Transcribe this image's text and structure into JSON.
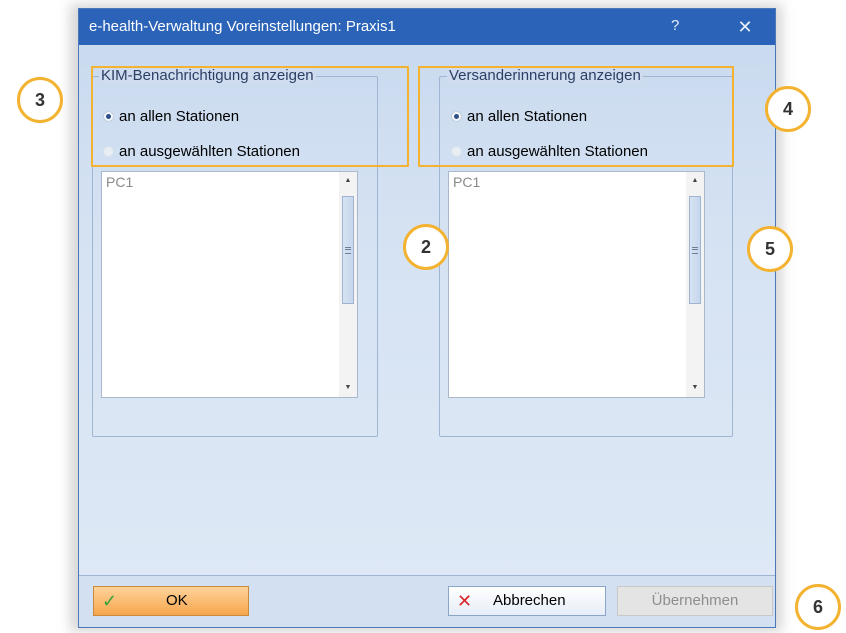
{
  "dialog": {
    "title": "e-health-Verwaltung Voreinstellungen: Praxis1",
    "help_label": "?",
    "close_label": "✕"
  },
  "kim_group": {
    "label": "KIM-Benachrichtigung anzeigen",
    "option_all": "an allen Stationen",
    "option_selected": "an ausgewählten Stationen",
    "selected": "an allen Stationen",
    "list_items": [
      "PC1"
    ]
  },
  "versand_group": {
    "label": "Versanderinnerung anzeigen",
    "option_all": "an allen Stationen",
    "option_selected": "an ausgewählten Stationen",
    "selected": "an allen Stationen",
    "list_items": [
      "PC1"
    ]
  },
  "footer": {
    "ok_label": "OK",
    "ok_icon": "checkmark-icon",
    "cancel_label": "Abbrechen",
    "cancel_icon": "cross-icon",
    "apply_label": "Übernehmen"
  },
  "callouts": {
    "c2": "2",
    "c3": "3",
    "c4": "4",
    "c5": "5",
    "c6": "6"
  },
  "colors": {
    "titlebar": "#2a63b8",
    "highlight": "#f3b230",
    "ok_button": "#f6a64c"
  }
}
